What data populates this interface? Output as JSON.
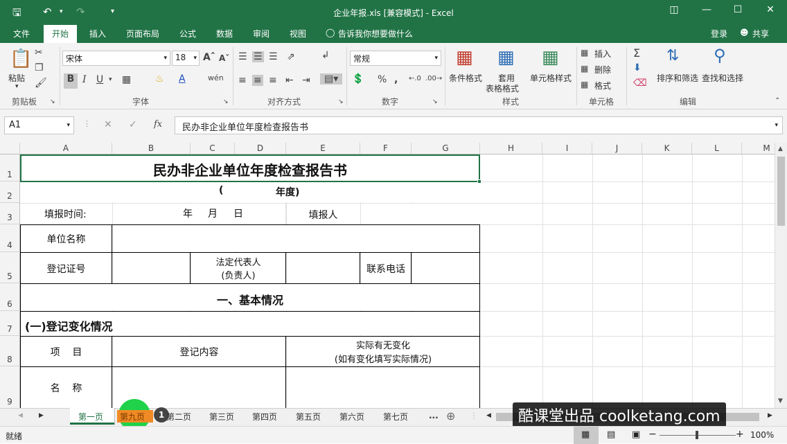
{
  "window": {
    "title": "企业年报.xls  [兼容模式] - Excel"
  },
  "tabs": [
    "文件",
    "开始",
    "插入",
    "页面布局",
    "公式",
    "数据",
    "审阅",
    "视图"
  ],
  "tell_me": "告诉我你想要做什么",
  "account": {
    "login": "登录",
    "share": "共享"
  },
  "ribbon": {
    "groups": {
      "clipboard": "剪贴板",
      "font": "字体",
      "alignment": "对齐方式",
      "number": "数字",
      "styles": "样式",
      "cells": "单元格",
      "editing": "编辑"
    },
    "paste": "粘贴",
    "font_name": "宋体",
    "font_size": "18",
    "number_format": "常规",
    "conditional_format": "条件格式",
    "table_format_1": "套用",
    "table_format_2": "表格格式",
    "cell_styles": "单元格样式",
    "insert": "插入",
    "delete": "删除",
    "format": "格式",
    "sort_filter": "排序和筛选",
    "find_select": "查找和选择"
  },
  "formula_bar": {
    "name_box": "A1",
    "content": "民办非企业单位年度检查报告书",
    "fx": "fx"
  },
  "columns": [
    "A",
    "B",
    "C",
    "D",
    "E",
    "F",
    "G",
    "H",
    "I",
    "J",
    "K",
    "L",
    "M"
  ],
  "rows": [
    "1",
    "2",
    "3",
    "4",
    "5",
    "6",
    "7",
    "8",
    "9"
  ],
  "cells": {
    "title": "民办非企业单位年度检查报告书",
    "year_open": "(",
    "year": "年度)",
    "fill_time": "填报时间:",
    "ymd_y": "年",
    "ymd_m": "月",
    "ymd_d": "日",
    "filler": "填报人",
    "unit_name": "单位名称",
    "reg_no": "登记证号",
    "legal_1": "法定代表人",
    "legal_2": "(负责人)",
    "phone": "联系电话",
    "section1": "一、基本情况",
    "sub1": "(一)登记变化情况",
    "item": "项    目",
    "reg_content": "登记内容",
    "change_1": "实际有无变化",
    "change_2": "(如有变化填写实际情况)",
    "name": "名    称"
  },
  "sheet_tabs": [
    "第一页",
    "第九页",
    "第二页",
    "第三页",
    "第四页",
    "第五页",
    "第六页",
    "第七页",
    "..."
  ],
  "badge": "1",
  "watermark": "酷课堂出品 coolketang.com",
  "status": {
    "ready": "就绪",
    "zoom": "100%"
  }
}
